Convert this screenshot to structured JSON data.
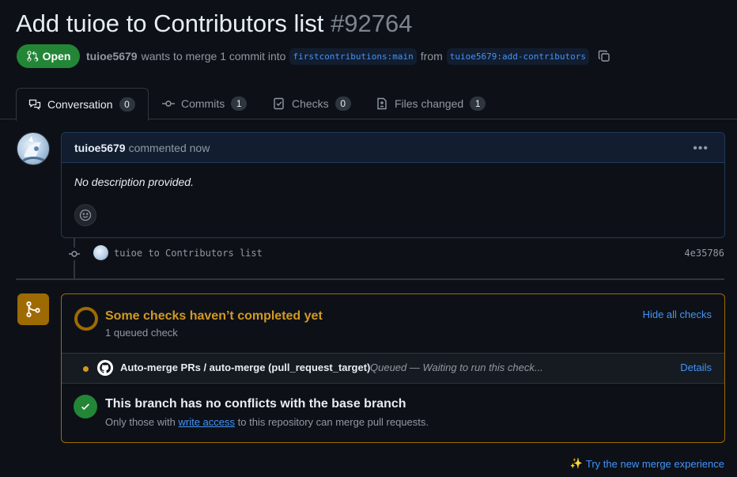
{
  "pr": {
    "title": "Add tuioe to Contributors list",
    "number": "#92764",
    "state": "Open",
    "author": "tuioe5679",
    "meta_text": "wants to merge 1 commit into",
    "base_branch": "firstcontributions:main",
    "from_text": "from",
    "head_branch": "tuioe5679:add-contributors"
  },
  "tabs": [
    {
      "label": "Conversation",
      "count": "0",
      "icon": "conversation-icon"
    },
    {
      "label": "Commits",
      "count": "1",
      "icon": "commit-icon"
    },
    {
      "label": "Checks",
      "count": "0",
      "icon": "checks-icon"
    },
    {
      "label": "Files changed",
      "count": "1",
      "icon": "file-diff-icon"
    }
  ],
  "comment": {
    "author": "tuioe5679",
    "action": "commented now",
    "body": "No description provided."
  },
  "commit": {
    "message": "tuioe to Contributors list",
    "sha": "4e35786"
  },
  "checks": {
    "title": "Some checks haven’t completed yet",
    "subtitle": "1 queued check",
    "hide_label": "Hide all checks",
    "items": [
      {
        "name": "Auto-merge PRs / auto-merge (pull_request_target)",
        "status": "Queued — Waiting to run this check...",
        "details_label": "Details"
      }
    ]
  },
  "merge": {
    "title": "This branch has no conflicts with the base branch",
    "sub_prefix": "Only those with",
    "sub_link": "write access",
    "sub_suffix": "to this repository can merge pull requests."
  },
  "footer": {
    "try_label": "Try the new merge experience"
  },
  "colors": {
    "open_green": "#238636",
    "pending_yellow": "#d29922",
    "link_blue": "#4493f8"
  }
}
